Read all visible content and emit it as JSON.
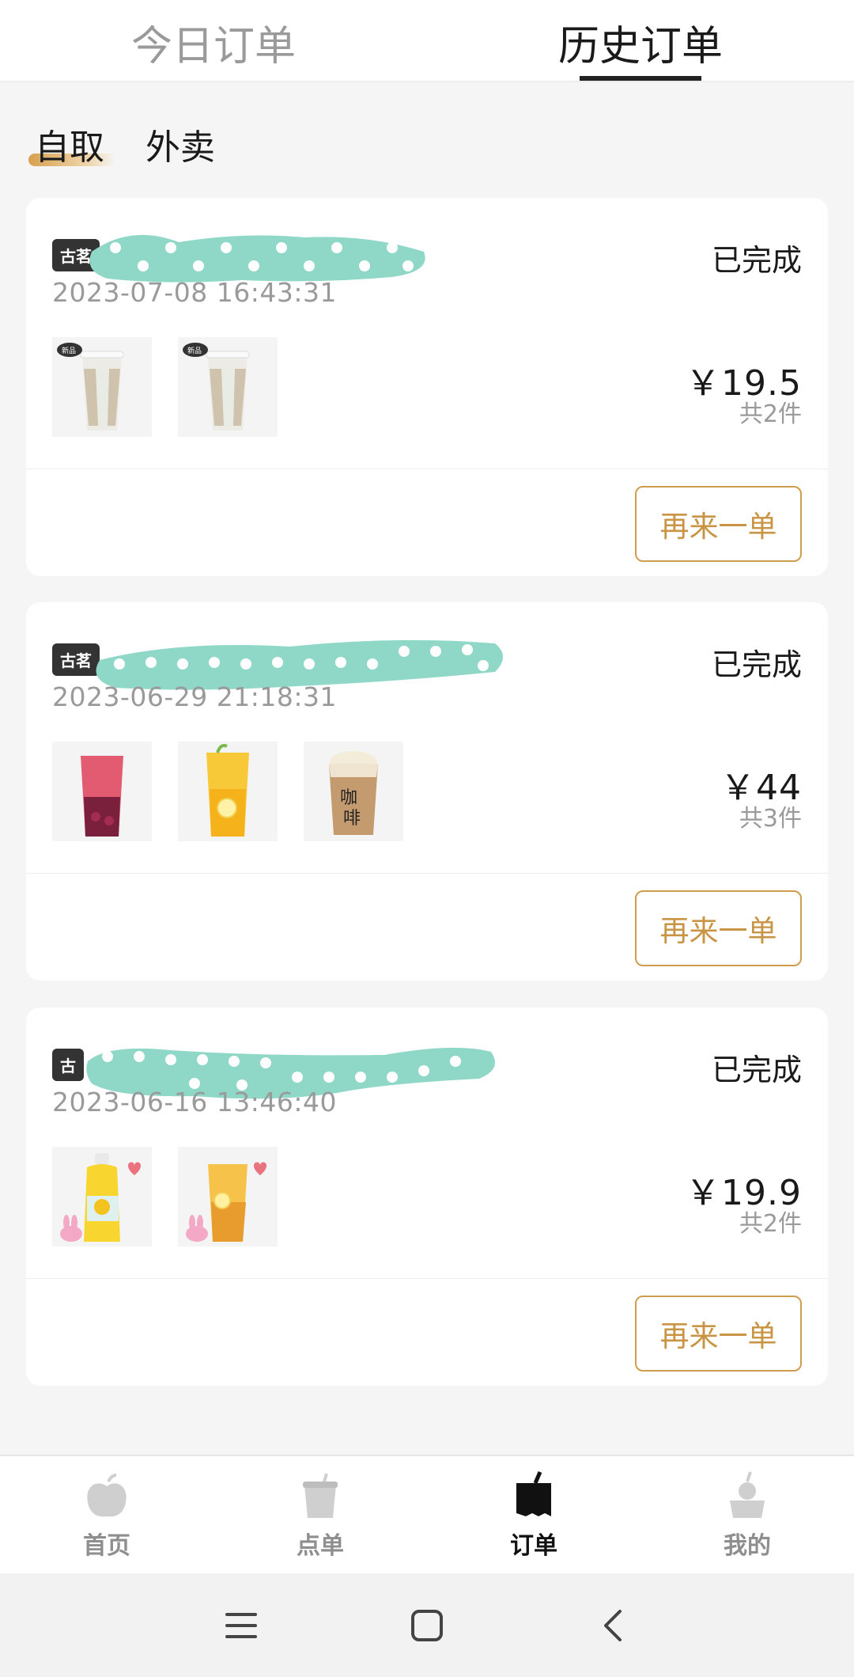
{
  "top_tabs": [
    {
      "label": "今日订单",
      "active": false
    },
    {
      "label": "历史订单",
      "active": true
    }
  ],
  "sub_tabs": [
    {
      "label": "自取",
      "active": true
    },
    {
      "label": "外卖",
      "active": false
    }
  ],
  "orders": [
    {
      "store_tag": "古茗",
      "time": "2023-07-08 16:43:31",
      "status": "已完成",
      "price": "￥19.5",
      "qty": "共2件",
      "items": [
        "new-milk-tea-cup",
        "new-milk-tea-cup"
      ],
      "reorder_label": "再来一单"
    },
    {
      "store_tag": "古茗",
      "time": "2023-06-29 21:18:31",
      "status": "已完成",
      "price": "￥44",
      "qty": "共3件",
      "items": [
        "berry-fruit-tea",
        "lemon-tea",
        "coffee-cup"
      ],
      "reorder_label": "再来一单"
    },
    {
      "store_tag": "古",
      "time": "2023-06-16 13:46:40",
      "status": "已完成",
      "price": "￥19.9",
      "qty": "共2件",
      "items": [
        "bottled-juice",
        "fruit-tea-cup"
      ],
      "reorder_label": "再来一单"
    }
  ],
  "bottom_nav": [
    {
      "label": "首页",
      "icon": "home-icon",
      "active": false
    },
    {
      "label": "点单",
      "icon": "menu-cup-icon",
      "active": false
    },
    {
      "label": "订单",
      "icon": "order-icon",
      "active": true
    },
    {
      "label": "我的",
      "icon": "profile-icon",
      "active": false
    }
  ],
  "colors": {
    "accent": "#cf9d4f",
    "scribble": "#8fd8c8"
  }
}
